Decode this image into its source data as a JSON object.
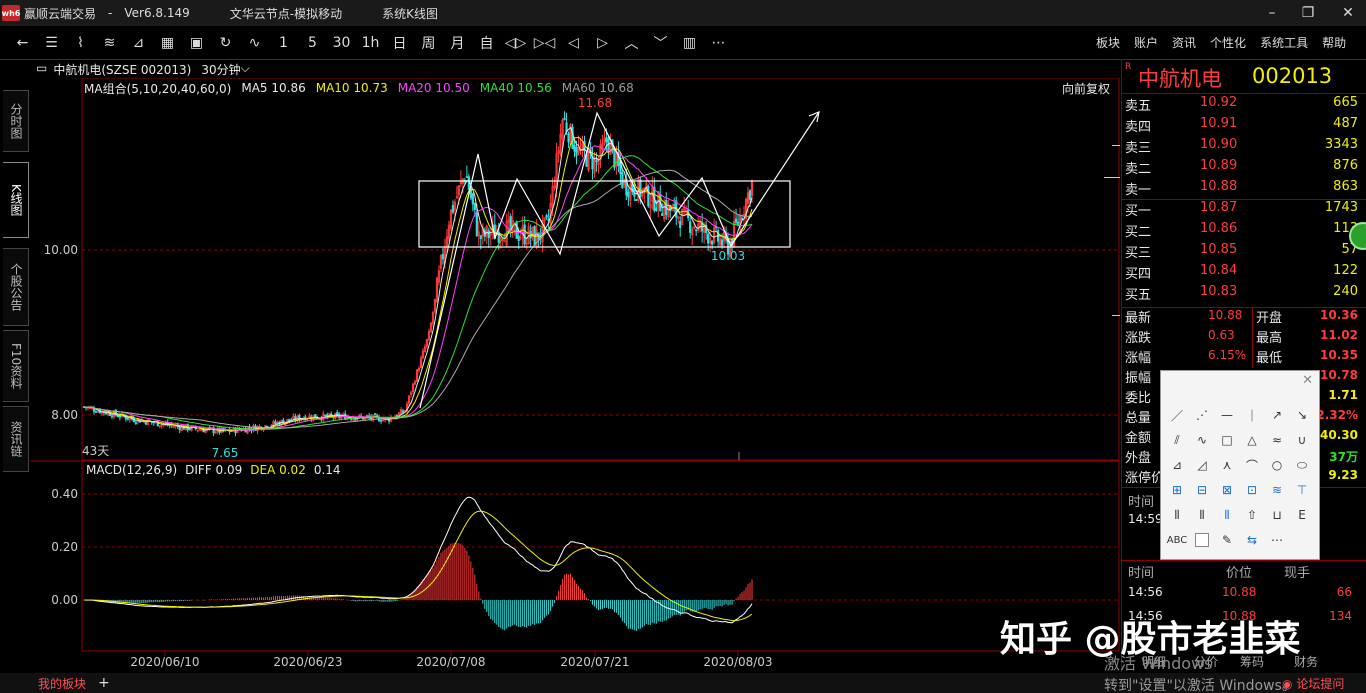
{
  "titlebar": {
    "app": "赢顺云端交易",
    "version": "Ver6.8.149",
    "node": "文华云节点-模拟移动",
    "view": "系统K线图",
    "min": "–",
    "max": "❐",
    "close": "✕"
  },
  "toolbar": {
    "buttons": [
      "←",
      "☰",
      "⌇",
      "≋",
      "⊿",
      "▦",
      "▣",
      "↻",
      "∿",
      "1",
      "5",
      "30",
      "1h",
      "日",
      "周",
      "月",
      "自",
      "◁▷",
      "▷◁",
      "◁",
      "▷",
      "︿",
      "﹀",
      "▥",
      "⋯"
    ],
    "right": [
      "板块",
      "账户",
      "资讯",
      "个性化",
      "系统工具",
      "帮助"
    ]
  },
  "lefttabs": [
    "分时图",
    "K线图",
    "个股公告",
    "F10资料",
    "资讯链"
  ],
  "chart_header": {
    "symbol": "中航机电(SZSE 002013)",
    "period": "30分钟",
    "ma_label": "MA组合(5,10,20,40,60,0)",
    "ma5": "MA5 10.86",
    "ma10": "MA10 10.73",
    "ma20": "MA20 10.50",
    "ma40": "MA40 10.56",
    "ma60": "MA60 10.68",
    "adjust": "向前复权"
  },
  "chart_data": {
    "type": "candlestick",
    "price_ticks": [
      "10.00",
      "8.00"
    ],
    "macd_ticks": [
      "0.40",
      "0.20",
      "0.00"
    ],
    "x_labels": [
      "2020/06/10",
      "2020/06/23",
      "2020/07/08",
      "2020/07/21",
      "2020/08/03"
    ],
    "high_label": "11.68",
    "low_label": "7.65",
    "recent_low_label": "10.03",
    "days_label": "43天",
    "macd_header": {
      "name": "MACD(12,26,9)",
      "diff": "DIFF 0.09",
      "dea": "DEA 0.02",
      "macd": "0.14"
    }
  },
  "quote": {
    "title": "中航机电",
    "code": "002013",
    "r": "R",
    "asks": [
      {
        "label": "卖五",
        "price": "10.92",
        "vol": "665"
      },
      {
        "label": "卖四",
        "price": "10.91",
        "vol": "487"
      },
      {
        "label": "卖三",
        "price": "10.90",
        "vol": "3343"
      },
      {
        "label": "卖二",
        "price": "10.89",
        "vol": "876"
      },
      {
        "label": "卖一",
        "price": "10.88",
        "vol": "863"
      }
    ],
    "bids": [
      {
        "label": "买一",
        "price": "10.87",
        "vol": "1743"
      },
      {
        "label": "买二",
        "price": "10.86",
        "vol": "113"
      },
      {
        "label": "买三",
        "price": "10.85",
        "vol": "57"
      },
      {
        "label": "买四",
        "price": "10.84",
        "vol": "122"
      },
      {
        "label": "买五",
        "price": "10.83",
        "vol": "240"
      }
    ],
    "stats_left": [
      {
        "label": "最新",
        "value": "10.88"
      },
      {
        "label": "涨跌",
        "value": "0.63"
      },
      {
        "label": "涨幅",
        "value": "6.15%"
      },
      {
        "label": "振幅",
        "value": ""
      },
      {
        "label": "委比",
        "value": ""
      },
      {
        "label": "总量",
        "value": ""
      },
      {
        "label": "金额",
        "value": ""
      },
      {
        "label": "外盘",
        "value": ""
      },
      {
        "label": "涨停价",
        "value": ""
      }
    ],
    "stats_right": [
      {
        "label": "开盘",
        "value": "10.36"
      },
      {
        "label": "最高",
        "value": "11.02"
      },
      {
        "label": "最低",
        "value": "10.35"
      },
      {
        "label": "",
        "value": "10.78"
      },
      {
        "label": "",
        "value": "1.71"
      },
      {
        "label": "",
        "value": "2.32%"
      },
      {
        "label": "",
        "value": "40.30"
      },
      {
        "label": "",
        "value": "37万"
      },
      {
        "label": "",
        "value": "9.23"
      }
    ],
    "time_label": "时间",
    "time_value": "14:59",
    "trades_header": [
      "时间",
      "价位",
      "现手"
    ],
    "trades": [
      {
        "time": "14:56",
        "price": "10.88",
        "vol": "66"
      },
      {
        "time": "14:56",
        "price": "10.88",
        "vol": "134"
      }
    ],
    "tabs": [
      "明细",
      "分价",
      "筹码",
      "财务"
    ]
  },
  "palette": {
    "close": "✕",
    "icons": [
      "／",
      "⋰",
      "—",
      "｜",
      "↗",
      "↘",
      "⫽",
      "∿",
      "□",
      "△",
      "≈",
      "∪",
      "⊿",
      "◿",
      "⋏",
      "⌒",
      "○",
      "⬭",
      "⊞",
      "⊟",
      "⊠",
      "⊡",
      "≋",
      "⊤",
      "⦀",
      "⦀",
      "⦀",
      "⇧",
      "⊔",
      "Ε",
      "ABC",
      "□",
      "✎",
      "⇆",
      "⋯"
    ]
  },
  "bottom": {
    "my_sector": "我的板块",
    "plus": "+",
    "forum": "论坛提问"
  },
  "watermark": "知乎 @股市老韭菜",
  "activate1": "激活 Windows",
  "activate2": "转到\"设置\"以激活 Windows。"
}
